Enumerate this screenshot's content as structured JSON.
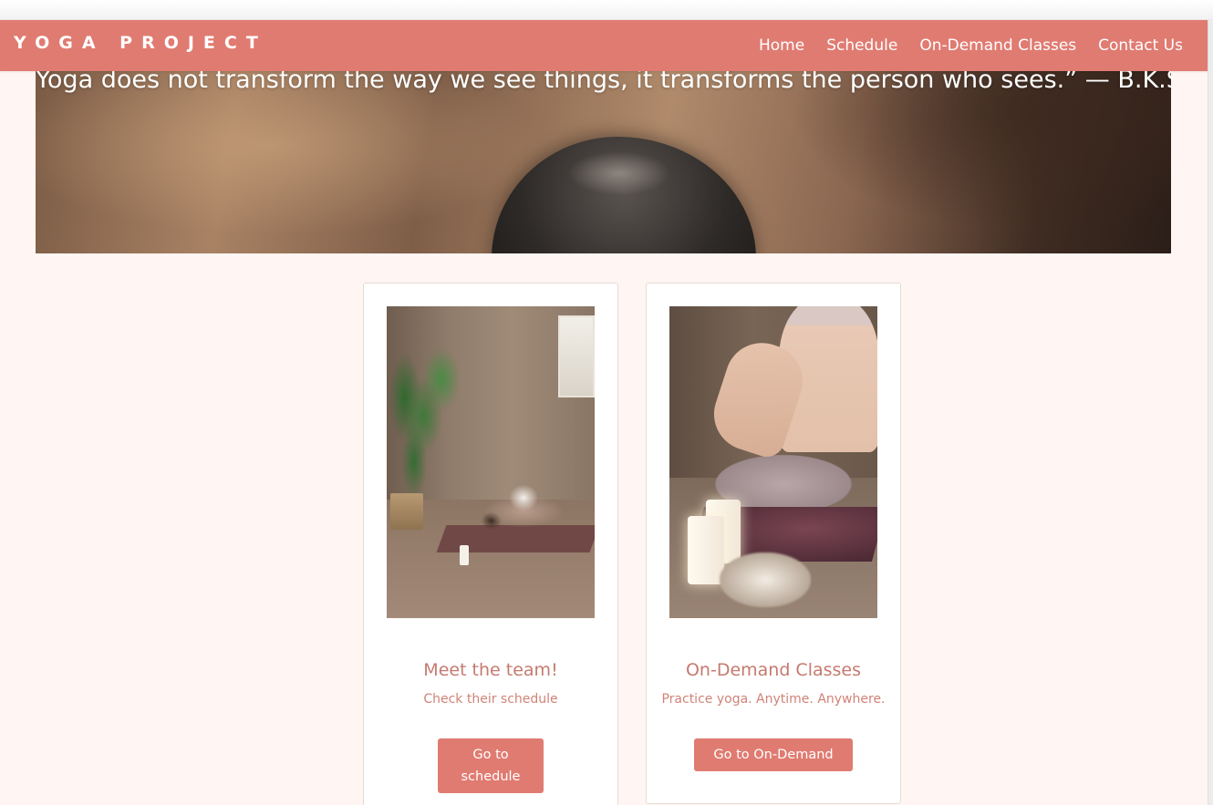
{
  "navbar": {
    "brand": "YOGA PROJECT",
    "links": [
      {
        "label": "Home"
      },
      {
        "label": "Schedule"
      },
      {
        "label": "On-Demand Classes"
      },
      {
        "label": "Contact Us"
      }
    ]
  },
  "hero": {
    "quote": "Yoga does not transform the way we see things, it transforms the person who sees.” — B.K.S. Iyengar"
  },
  "cards": [
    {
      "title": "Meet the team!",
      "subtitle": "Check their schedule",
      "button_label": "Go to schedule"
    },
    {
      "title": "On-Demand Classes",
      "subtitle": "Practice yoga. Anytime. Anywhere.",
      "button_label": "Go to On-Demand"
    }
  ],
  "colors": {
    "navbar": "#e07b71",
    "page_background": "#fff5f2",
    "accent_text": "#c57a6f",
    "button": "#e07b71"
  }
}
